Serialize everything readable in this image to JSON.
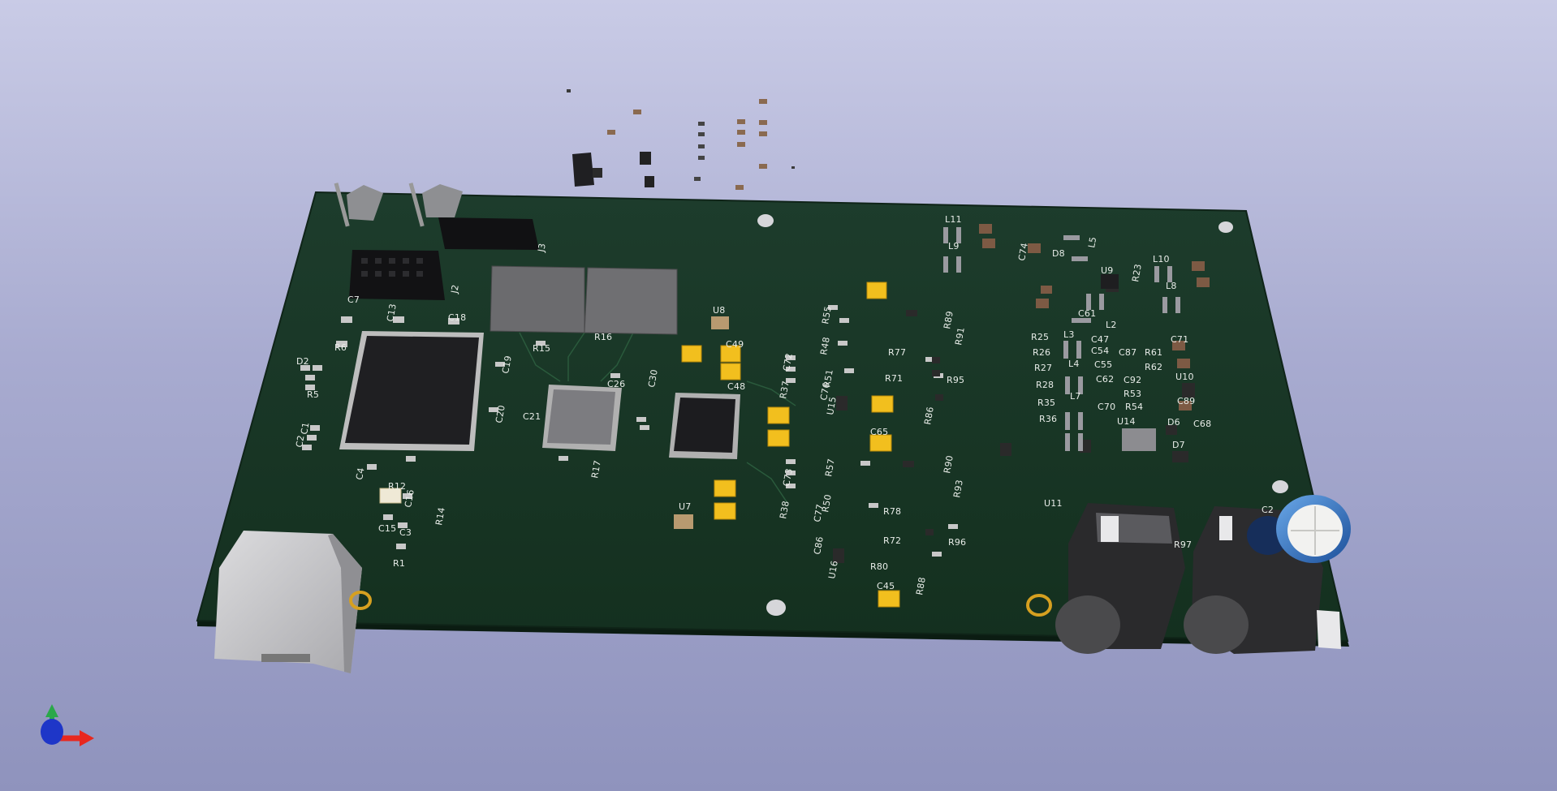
{
  "app": {
    "view": "3D Viewer"
  },
  "colors": {
    "board": "#183526",
    "background_top": "#c9cbe6",
    "background_bottom": "#8f93bd",
    "silkscreen": "#e8ece8",
    "tantalum": "#f2bf1e",
    "ic_body": "#1f1f22",
    "usb_shell": "#c2c2c4"
  },
  "silkscreen": {
    "J3": "J3",
    "J2": "J2",
    "C7": "C7",
    "C13": "C13",
    "C18": "C18",
    "R6": "R6",
    "D2": "D2",
    "R5": "R5",
    "C1": "C1",
    "C2": "C2",
    "C19": "C19",
    "C20": "C20",
    "C4": "C4",
    "R12": "R12",
    "C16": "C16",
    "R14": "R14",
    "C15": "C15",
    "C3": "C3",
    "R1": "R1",
    "R15": "R15",
    "R16": "R16",
    "C26": "C26",
    "C21": "C21",
    "R17": "R17",
    "U8": "U8",
    "C30": "C30",
    "C49": "C49",
    "C48": "C48",
    "U7": "U7",
    "C72": "C72",
    "R37": "R37",
    "C76": "C76",
    "C73": "C73",
    "R38": "R38",
    "C77": "C77",
    "R55": "R55",
    "R48": "R48",
    "R51": "R51",
    "U15": "U15",
    "R57": "R57",
    "R50": "R50",
    "C86": "C86",
    "U16": "U16",
    "R89": "R89",
    "R91": "R91",
    "R95": "R95",
    "R86": "R86",
    "R77": "R77",
    "R71": "R71",
    "C65": "C65",
    "C45": "C45",
    "R90": "R90",
    "R93": "R93",
    "R78": "R78",
    "R72": "R72",
    "R80": "R80",
    "R96": "R96",
    "R88": "R88",
    "L11": "L11",
    "L9": "L9",
    "C74": "C74",
    "L5": "L5",
    "D8": "D8",
    "U9": "U9",
    "R23": "R23",
    "L10": "L10",
    "L8": "L8",
    "C61": "C61",
    "L2": "L2",
    "L3": "L3",
    "C47": "C47",
    "R25": "R25",
    "R26": "R26",
    "R27": "R27",
    "R28": "R28",
    "R35": "R35",
    "R36": "R36",
    "L4": "L4",
    "L7": "L7",
    "C54": "C54",
    "C55": "C55",
    "C62": "C62",
    "C87": "C87",
    "R61": "R61",
    "R62": "R62",
    "C92": "C92",
    "R53": "R53",
    "C70": "C70",
    "R54": "R54",
    "U14": "U14",
    "C71": "C71",
    "U10": "U10",
    "C89": "C89",
    "D6": "D6",
    "D7": "D7",
    "C68": "C68",
    "U11": "U11",
    "R97": "R97",
    "C2x": "C2"
  },
  "axis": {
    "x_icon": "x-axis-arrow",
    "y_icon": "y-axis-cone",
    "z_icon": "z-axis-arrow"
  }
}
